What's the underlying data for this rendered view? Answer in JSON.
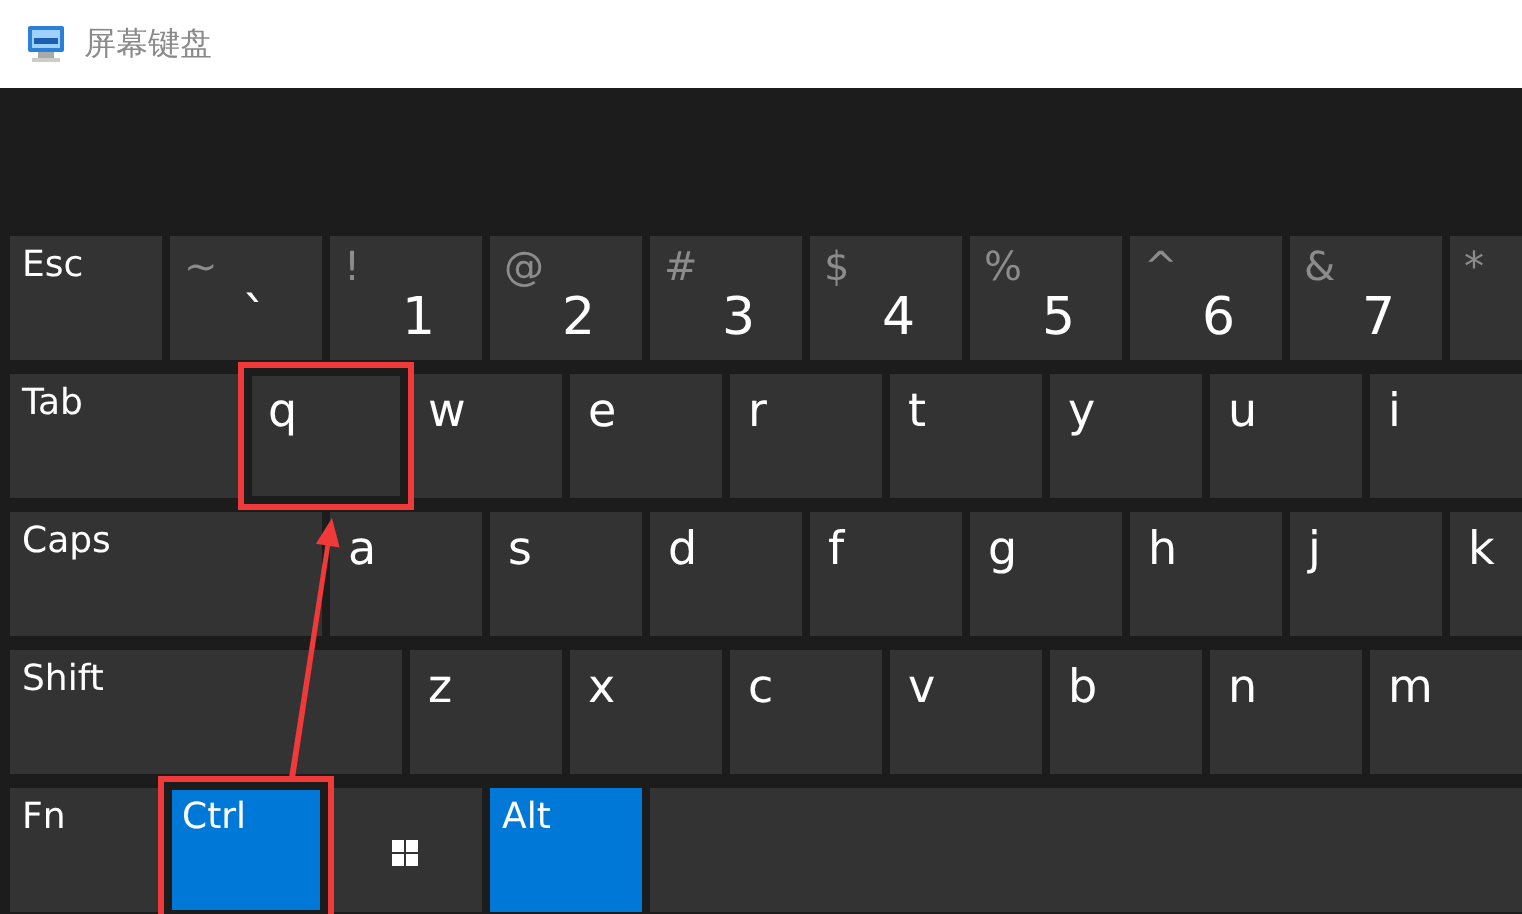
{
  "window": {
    "title": "屏幕键盘"
  },
  "rows": [
    {
      "keys": [
        {
          "kind": "mod",
          "label": "Esc",
          "pressed": false,
          "marked": false
        },
        {
          "kind": "symbol",
          "shift": "~",
          "label": "`",
          "pressed": false,
          "marked": false
        },
        {
          "kind": "symbol",
          "shift": "!",
          "label": "1",
          "pressed": false,
          "marked": false
        },
        {
          "kind": "symbol",
          "shift": "@",
          "label": "2",
          "pressed": false,
          "marked": false
        },
        {
          "kind": "symbol",
          "shift": "#",
          "label": "3",
          "pressed": false,
          "marked": false
        },
        {
          "kind": "symbol",
          "shift": "$",
          "label": "4",
          "pressed": false,
          "marked": false
        },
        {
          "kind": "symbol",
          "shift": "%",
          "label": "5",
          "pressed": false,
          "marked": false
        },
        {
          "kind": "symbol",
          "shift": "^",
          "label": "6",
          "pressed": false,
          "marked": false
        },
        {
          "kind": "symbol",
          "shift": "&",
          "label": "7",
          "pressed": false,
          "marked": false
        },
        {
          "kind": "symbol",
          "shift": "*",
          "pressed": false,
          "marked": false
        }
      ]
    },
    {
      "keys": [
        {
          "kind": "mod",
          "label": "Tab",
          "pressed": false,
          "marked": false
        },
        {
          "kind": "letter",
          "label": "q",
          "pressed": false,
          "marked": true
        },
        {
          "kind": "letter",
          "label": "w",
          "pressed": false,
          "marked": false
        },
        {
          "kind": "letter",
          "label": "e",
          "pressed": false,
          "marked": false
        },
        {
          "kind": "letter",
          "label": "r",
          "pressed": false,
          "marked": false
        },
        {
          "kind": "letter",
          "label": "t",
          "pressed": false,
          "marked": false
        },
        {
          "kind": "letter",
          "label": "y",
          "pressed": false,
          "marked": false
        },
        {
          "kind": "letter",
          "label": "u",
          "pressed": false,
          "marked": false
        },
        {
          "kind": "letter",
          "label": "i",
          "pressed": false,
          "marked": false
        }
      ]
    },
    {
      "keys": [
        {
          "kind": "mod",
          "label": "Caps",
          "pressed": false,
          "marked": false
        },
        {
          "kind": "letter",
          "label": "a",
          "pressed": false,
          "marked": false
        },
        {
          "kind": "letter",
          "label": "s",
          "pressed": false,
          "marked": false
        },
        {
          "kind": "letter",
          "label": "d",
          "pressed": false,
          "marked": false
        },
        {
          "kind": "letter",
          "label": "f",
          "pressed": false,
          "marked": false
        },
        {
          "kind": "letter",
          "label": "g",
          "pressed": false,
          "marked": false
        },
        {
          "kind": "letter",
          "label": "h",
          "pressed": false,
          "marked": false
        },
        {
          "kind": "letter",
          "label": "j",
          "pressed": false,
          "marked": false
        },
        {
          "kind": "letter",
          "label": "k",
          "pressed": false,
          "marked": false
        }
      ]
    },
    {
      "keys": [
        {
          "kind": "mod",
          "label": "Shift",
          "pressed": false,
          "marked": false
        },
        {
          "kind": "letter",
          "label": "z",
          "pressed": false,
          "marked": false
        },
        {
          "kind": "letter",
          "label": "x",
          "pressed": false,
          "marked": false
        },
        {
          "kind": "letter",
          "label": "c",
          "pressed": false,
          "marked": false
        },
        {
          "kind": "letter",
          "label": "v",
          "pressed": false,
          "marked": false
        },
        {
          "kind": "letter",
          "label": "b",
          "pressed": false,
          "marked": false
        },
        {
          "kind": "letter",
          "label": "n",
          "pressed": false,
          "marked": false
        },
        {
          "kind": "letter",
          "label": "m",
          "pressed": false,
          "marked": false
        }
      ]
    },
    {
      "keys": [
        {
          "kind": "mod",
          "label": "Fn",
          "pressed": false,
          "marked": false
        },
        {
          "kind": "mod",
          "label": "Ctrl",
          "pressed": true,
          "marked": true
        },
        {
          "kind": "win",
          "pressed": false,
          "marked": false
        },
        {
          "kind": "mod",
          "label": "Alt",
          "pressed": true,
          "marked": false
        },
        {
          "kind": "space",
          "pressed": false,
          "marked": false
        }
      ]
    }
  ],
  "annotations": {
    "arrow_between_marked": true
  }
}
